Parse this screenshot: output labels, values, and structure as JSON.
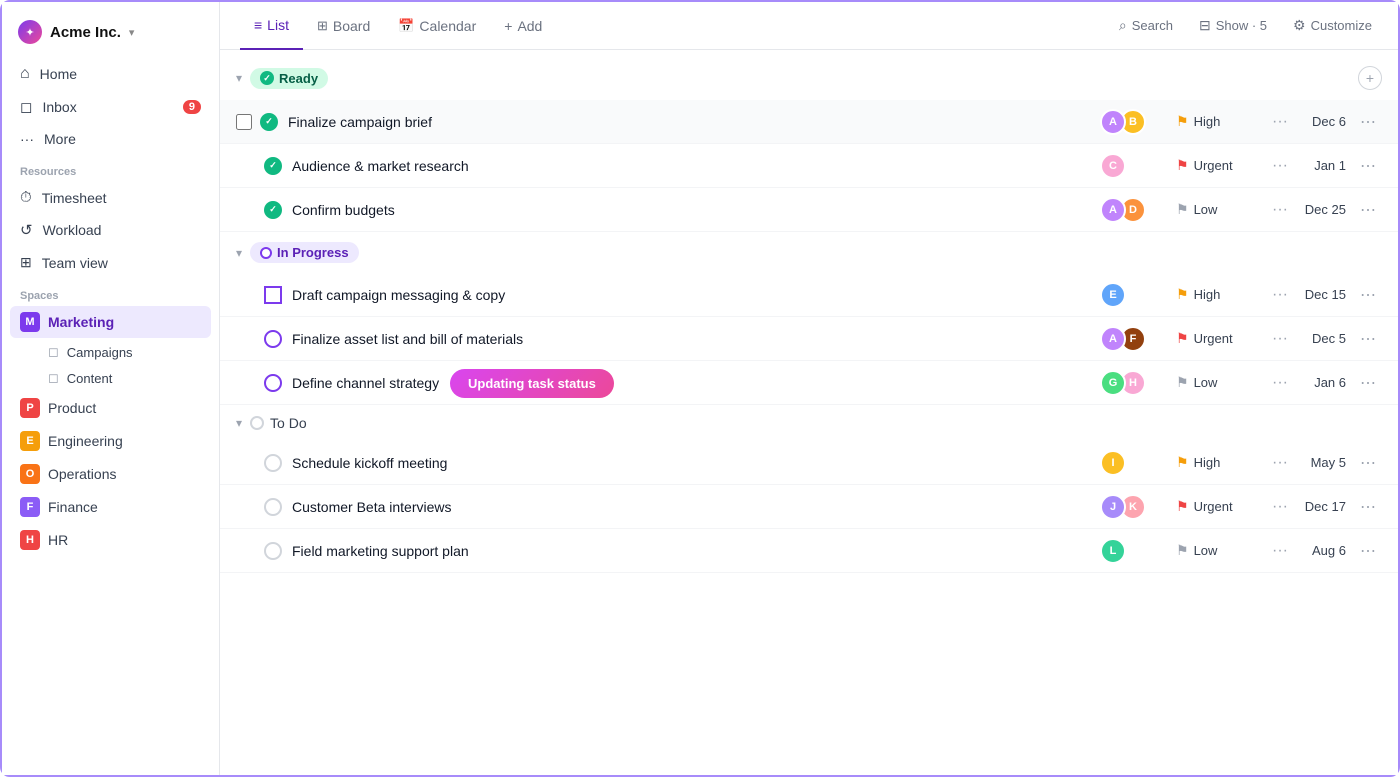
{
  "app": {
    "name": "Acme Inc.",
    "caret": "▾"
  },
  "sidebar": {
    "nav": [
      {
        "id": "home",
        "label": "Home",
        "icon": "home"
      },
      {
        "id": "inbox",
        "label": "Inbox",
        "icon": "inbox",
        "badge": "9"
      },
      {
        "id": "more",
        "label": "More",
        "icon": "more"
      }
    ],
    "resources_label": "Resources",
    "resources": [
      {
        "id": "timesheet",
        "label": "Timesheet",
        "icon": "timesheet"
      },
      {
        "id": "workload",
        "label": "Workload",
        "icon": "workload"
      },
      {
        "id": "team-view",
        "label": "Team view",
        "icon": "team"
      }
    ],
    "spaces_label": "Spaces",
    "spaces": [
      {
        "id": "marketing",
        "label": "Marketing",
        "badgeChar": "M",
        "badgeClass": "badge-m",
        "active": true,
        "subs": [
          {
            "id": "campaigns",
            "label": "Campaigns"
          },
          {
            "id": "content",
            "label": "Content"
          }
        ]
      },
      {
        "id": "product",
        "label": "Product",
        "badgeChar": "P",
        "badgeClass": "badge-p",
        "active": false,
        "subs": []
      },
      {
        "id": "engineering",
        "label": "Engineering",
        "badgeChar": "E",
        "badgeClass": "badge-e",
        "active": false,
        "subs": []
      },
      {
        "id": "operations",
        "label": "Operations",
        "badgeChar": "O",
        "badgeClass": "badge-o",
        "active": false,
        "subs": []
      },
      {
        "id": "finance",
        "label": "Finance",
        "badgeChar": "F",
        "badgeClass": "badge-f",
        "active": false,
        "subs": []
      },
      {
        "id": "hr",
        "label": "HR",
        "badgeChar": "H",
        "badgeClass": "badge-h",
        "active": false,
        "subs": []
      }
    ]
  },
  "toolbar": {
    "tabs": [
      {
        "id": "list",
        "label": "List",
        "icon": "≡",
        "active": true
      },
      {
        "id": "board",
        "label": "Board",
        "icon": "⊞",
        "active": false
      },
      {
        "id": "calendar",
        "label": "Calendar",
        "icon": "📅",
        "active": false
      },
      {
        "id": "add",
        "label": "Add",
        "icon": "+",
        "active": false
      }
    ],
    "search_label": "Search",
    "show_label": "Show · 5",
    "customize_label": "Customize"
  },
  "groups": [
    {
      "id": "ready",
      "label": "Ready",
      "type": "ready",
      "tasks": [
        {
          "id": "t1",
          "name": "Finalize campaign brief",
          "avatars": [
            "#c084fc",
            "#fbbf24"
          ],
          "priority": "High",
          "priorityType": "high",
          "date": "Dec 6",
          "hasCheckbox": true,
          "statusType": "green-check"
        },
        {
          "id": "t2",
          "name": "Audience & market research",
          "avatars": [
            "#f9a8d4"
          ],
          "priority": "Urgent",
          "priorityType": "urgent",
          "date": "Jan 1",
          "hasCheckbox": false,
          "statusType": "green-check"
        },
        {
          "id": "t3",
          "name": "Confirm budgets",
          "avatars": [
            "#c084fc",
            "#fb923c"
          ],
          "priority": "Low",
          "priorityType": "low",
          "date": "Dec 25",
          "hasCheckbox": false,
          "statusType": "green-check"
        }
      ]
    },
    {
      "id": "inprogress",
      "label": "In Progress",
      "type": "inprogress",
      "tasks": [
        {
          "id": "t4",
          "name": "Draft campaign messaging & copy",
          "avatars": [
            "#60a5fa"
          ],
          "priority": "High",
          "priorityType": "high",
          "date": "Dec 15",
          "statusType": "blue-circle"
        },
        {
          "id": "t5",
          "name": "Finalize asset list and bill of materials",
          "avatars": [
            "#c084fc",
            "#92400e"
          ],
          "priority": "Urgent",
          "priorityType": "urgent",
          "date": "Dec 5",
          "statusType": "blue-circle"
        },
        {
          "id": "t6",
          "name": "Define channel strategy",
          "avatars": [
            "#4ade80",
            "#f9a8d4"
          ],
          "priority": "Low",
          "priorityType": "low",
          "date": "Jan 6",
          "statusType": "blue-circle",
          "hasTooltip": true,
          "tooltipText": "Updating task status"
        }
      ]
    },
    {
      "id": "todo",
      "label": "To Do",
      "type": "todo",
      "tasks": [
        {
          "id": "t7",
          "name": "Schedule kickoff meeting",
          "avatars": [
            "#fbbf24"
          ],
          "priority": "High",
          "priorityType": "high",
          "date": "May 5",
          "statusType": "empty-circle"
        },
        {
          "id": "t8",
          "name": "Customer Beta interviews",
          "avatars": [
            "#a78bfa",
            "#fda4af"
          ],
          "priority": "Urgent",
          "priorityType": "urgent",
          "date": "Dec 17",
          "statusType": "empty-circle"
        },
        {
          "id": "t9",
          "name": "Field marketing support plan",
          "avatars": [
            "#34d399"
          ],
          "priority": "Low",
          "priorityType": "low",
          "date": "Aug 6",
          "statusType": "empty-circle"
        }
      ]
    }
  ]
}
